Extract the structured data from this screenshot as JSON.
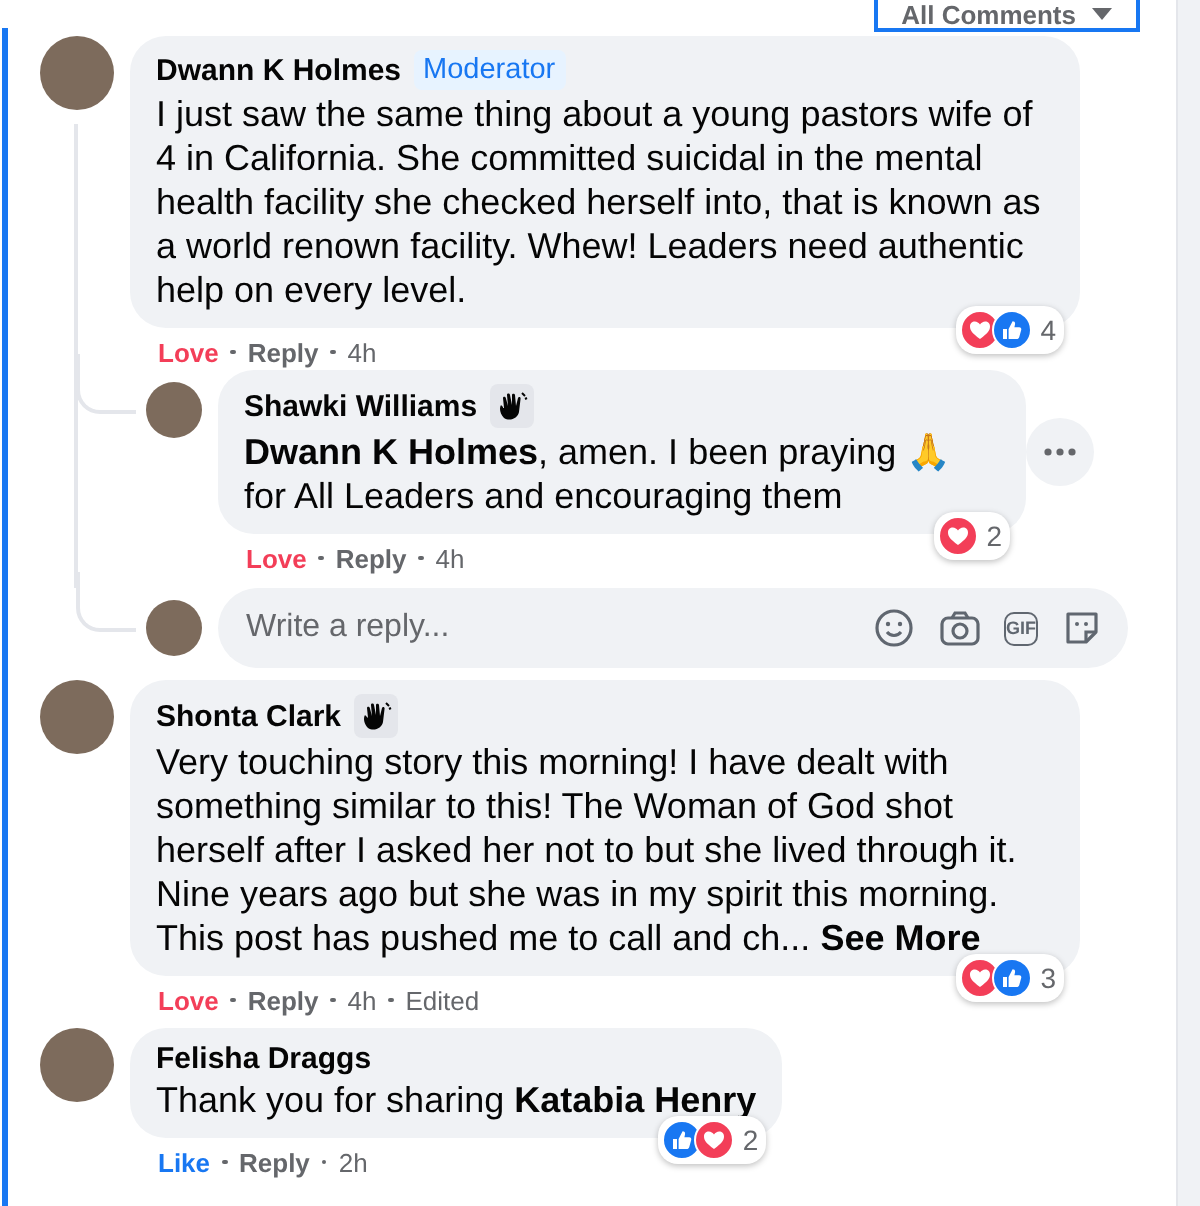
{
  "sort_menu": {
    "label": "All Comments"
  },
  "comments": [
    {
      "author": "Dwann K Holmes",
      "badge": {
        "kind": "label",
        "text": "Moderator"
      },
      "text": "I just saw the same thing about a young pastors wife of 4 in California. She committed suicidal in the mental health facility she checked herself into, that is known as a world renown facility. Whew! Leaders need authentic help on every level.",
      "reactions": [
        {
          "kind": "love"
        },
        {
          "kind": "like"
        }
      ],
      "reaction_count": "4",
      "actions": {
        "reaction": {
          "kind": "love",
          "label": "Love"
        },
        "reply": "Reply",
        "time": "4h"
      },
      "replies": [
        {
          "author": "Shawki Williams",
          "badge": {
            "kind": "wave"
          },
          "text": "**Dwann K Holmes**, amen. I been praying 🙏 for All Leaders and encouraging them",
          "reactions": [
            {
              "kind": "love"
            }
          ],
          "reaction_count": "2",
          "actions": {
            "reaction": {
              "kind": "love",
              "label": "Love"
            },
            "reply": "Reply",
            "time": "4h"
          },
          "more_button": true
        }
      ],
      "reply_box": {
        "placeholder": "Write a reply...",
        "gif_label": "GIF"
      }
    },
    {
      "author": "Shonta Clark",
      "badge": {
        "kind": "wave"
      },
      "text": "Very touching story this morning! I have dealt with something similar to this! The Woman of God shot herself after I asked her not to but she lived through it. Nine years ago but she was in my spirit this morning. This post has pushed me to call and ch...",
      "see_more": "See More",
      "reactions": [
        {
          "kind": "love"
        },
        {
          "kind": "like"
        }
      ],
      "reaction_count": "3",
      "actions": {
        "reaction": {
          "kind": "love",
          "label": "Love"
        },
        "reply": "Reply",
        "time": "4h",
        "edited": "Edited"
      }
    },
    {
      "author": "Felisha Draggs",
      "text": "Thank you for sharing **Katabia Henry**",
      "reactions": [
        {
          "kind": "like"
        },
        {
          "kind": "love"
        }
      ],
      "reaction_count": "2",
      "actions": {
        "reaction": {
          "kind": "like",
          "label": "Like"
        },
        "reply": "Reply",
        "time": "2h"
      }
    }
  ]
}
